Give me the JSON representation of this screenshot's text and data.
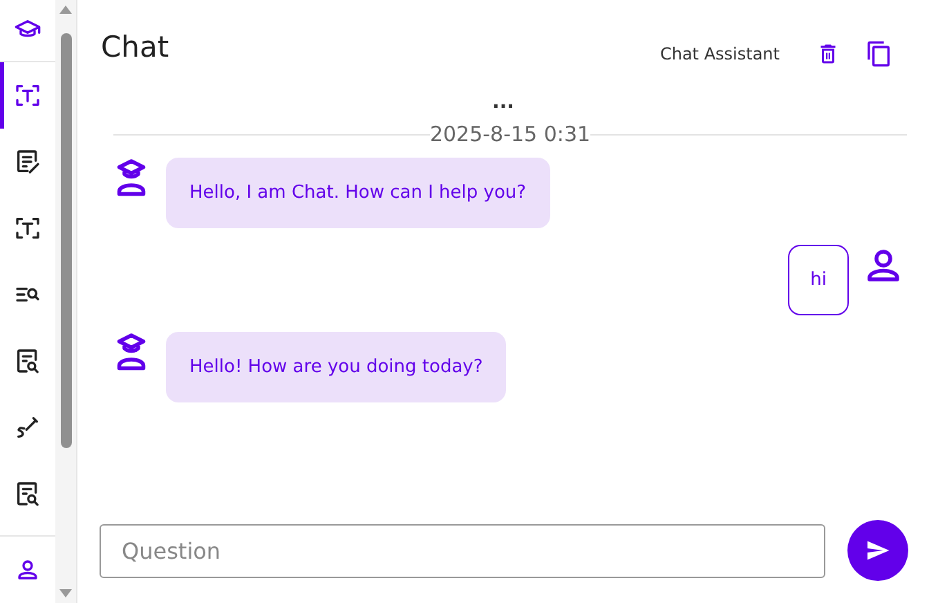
{
  "sidebar": {
    "items": [
      {
        "kind": "scan",
        "selected": true
      },
      {
        "kind": "edit-note",
        "selected": false
      },
      {
        "kind": "scan",
        "selected": false
      },
      {
        "kind": "list-search",
        "selected": false
      },
      {
        "kind": "doc-search",
        "selected": false
      },
      {
        "kind": "pen",
        "selected": false
      },
      {
        "kind": "doc-search",
        "selected": false
      }
    ]
  },
  "header": {
    "title": "Chat",
    "assistant": "Chat Assistant"
  },
  "more": "...",
  "date": "2025-8-15 0:31",
  "messages": [
    {
      "kind": "bot",
      "text": "Hello, I am Chat. How can I help you?"
    },
    {
      "kind": "user",
      "text": "hi"
    },
    {
      "kind": "bot",
      "text": "Hello! How are you doing today?"
    }
  ],
  "input": {
    "placeholder": "Question"
  }
}
